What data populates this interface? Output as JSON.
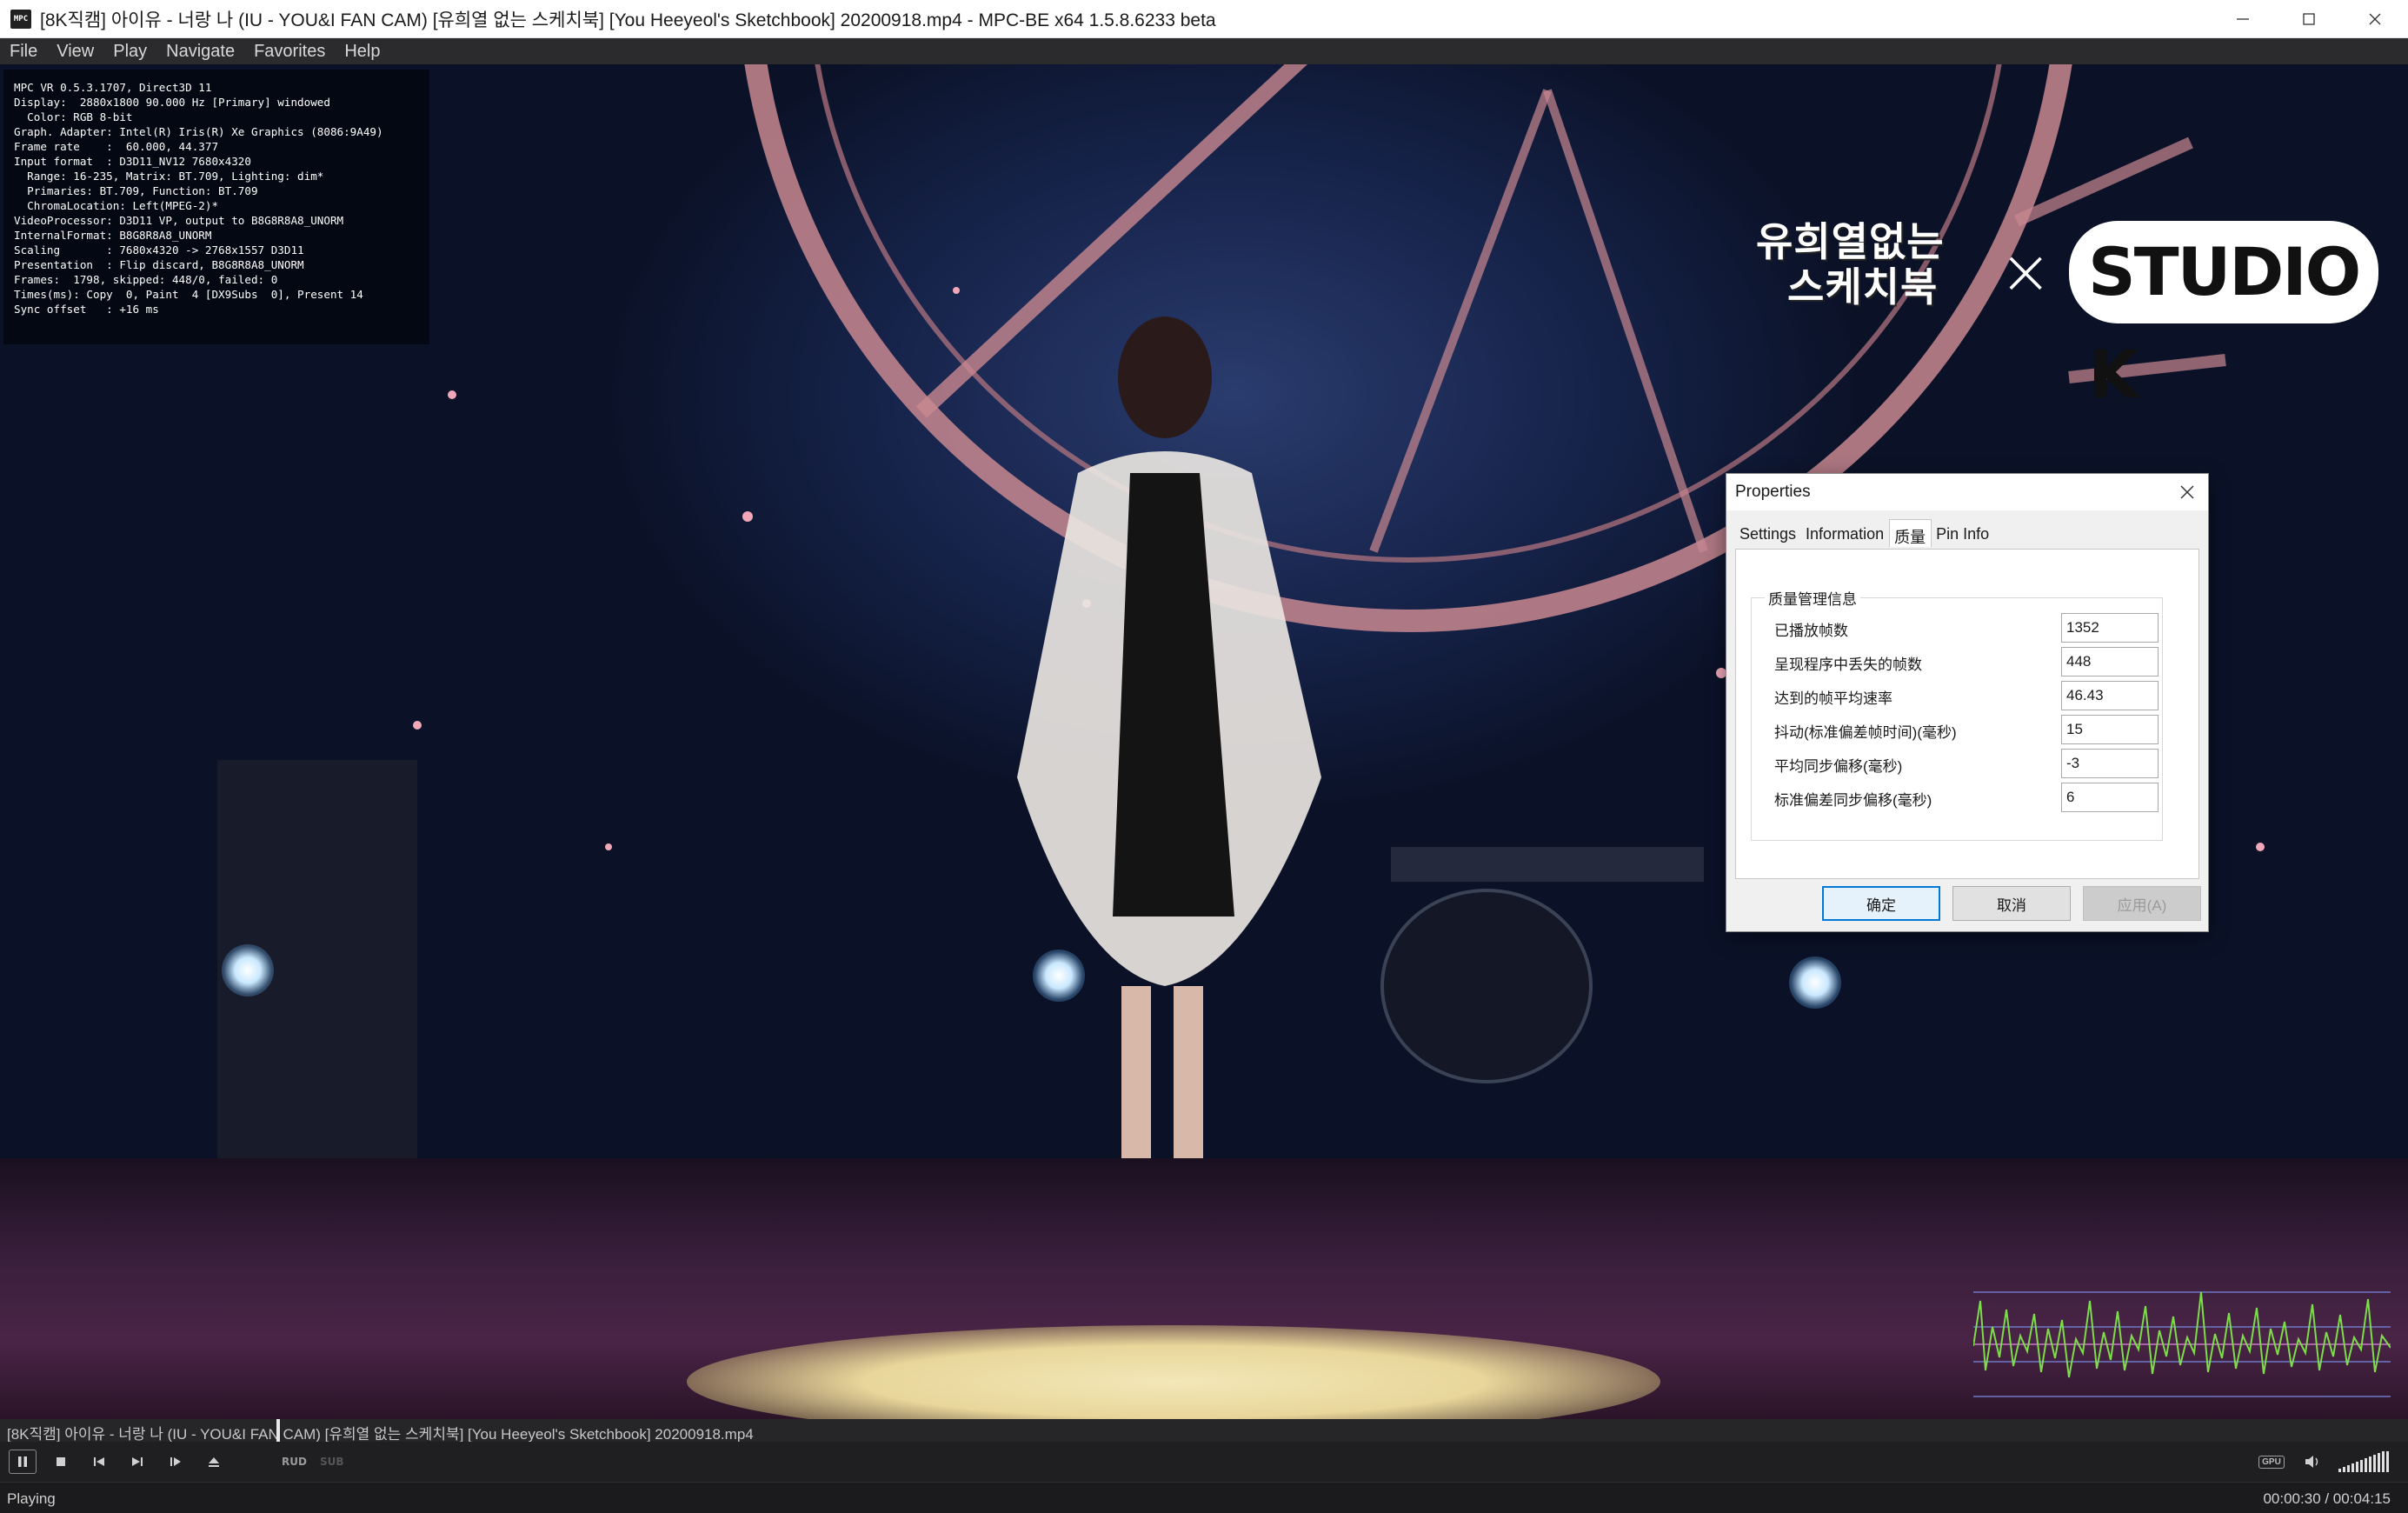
{
  "window": {
    "title": "[8K직캠] 아이유 - 너랑 나 (IU - YOU&I FAN CAM) [유희열 없는 스케치북] [You Heeyeol's Sketchbook] 20200918.mp4 - MPC-BE x64 1.5.8.6233 beta",
    "app_icon_text": "MPC"
  },
  "menu": {
    "items": [
      "File",
      "View",
      "Play",
      "Navigate",
      "Favorites",
      "Help"
    ]
  },
  "osd": {
    "lines": [
      "MPC VR 0.5.3.1707, Direct3D 11",
      "Display:  2880x1800 90.000 Hz [Primary] windowed",
      "  Color: RGB 8-bit",
      "Graph. Adapter: Intel(R) Iris(R) Xe Graphics (8086:9A49)",
      "Frame rate    :  60.000, 44.377",
      "Input format  : D3D11_NV12 7680x4320",
      "  Range: 16-235, Matrix: BT.709, Lighting: dim*",
      "  Primaries: BT.709, Function: BT.709",
      "  ChromaLocation: Left(MPEG-2)*",
      "VideoProcessor: D3D11 VP, output to B8G8R8A8_UNORM",
      "InternalFormat: B8G8R8A8_UNORM",
      "Scaling       : 7680x4320 -> 2768x1557 D3D11",
      "Presentation  : Flip discard, B8G8R8A8_UNORM",
      "Frames:  1798, skipped: 448/0, failed: 0",
      "Times(ms): Copy  0, Paint  4 [DX9Subs  0], Present 14",
      "Sync offset   : +16 ms"
    ]
  },
  "logo": {
    "line1": "유희열없는",
    "line2": "스케치북",
    "studio": "STUDIO K"
  },
  "dialog": {
    "title": "Properties",
    "tabs": [
      "Settings",
      "Information",
      "质量",
      "Pin Info"
    ],
    "active_tab": "质量",
    "group_title": "质量管理信息",
    "rows": [
      {
        "label": "已播放帧数",
        "value": "1352"
      },
      {
        "label": "呈现程序中丢失的帧数",
        "value": "448"
      },
      {
        "label": "达到的帧平均速率",
        "value": "46.43"
      },
      {
        "label": "抖动(标准偏差帧时间)(毫秒)",
        "value": "15"
      },
      {
        "label": "平均同步偏移(毫秒)",
        "value": "-3"
      },
      {
        "label": "标准偏差同步偏移(毫秒)",
        "value": "6"
      }
    ],
    "ok": "确定",
    "cancel": "取消",
    "apply": "应用(A)"
  },
  "filebar": {
    "text": "[8K직캠] 아이유 - 너랑 나 (IU - YOU&I FAN CAM) [유희열 없는 스케치북] [You Heeyeol's Sketchbook] 20200918.mp4"
  },
  "toolbar": {
    "rud": "RUD",
    "sub": "SUB",
    "gpu": "GPU"
  },
  "status": {
    "state": "Playing",
    "time": "00:00:30 / 00:04:15"
  },
  "colors": {
    "graph_line": "#7ddc4a",
    "graph_bg_line": "#6f78c8",
    "dialog_primary_border": "#0078d7"
  }
}
